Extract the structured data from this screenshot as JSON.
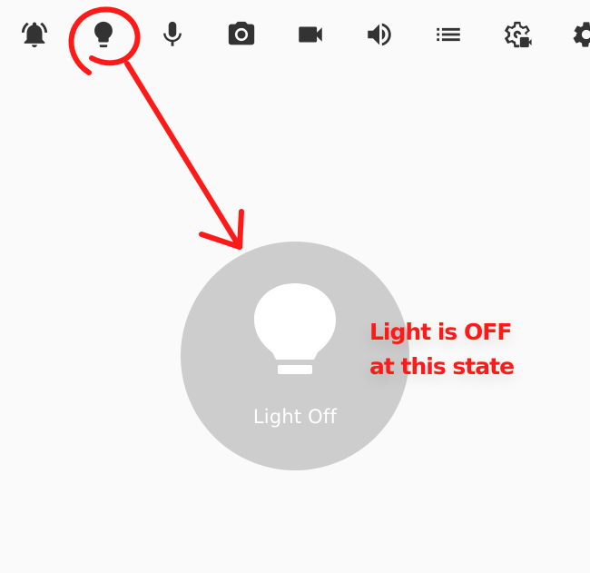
{
  "toolbar": {
    "items": [
      {
        "icon": "alarm-bell-icon"
      },
      {
        "icon": "lightbulb-icon",
        "highlighted": true
      },
      {
        "icon": "microphone-icon"
      },
      {
        "icon": "camera-icon"
      },
      {
        "icon": "video-camera-icon"
      },
      {
        "icon": "volume-icon"
      },
      {
        "icon": "list-icon"
      },
      {
        "icon": "camera-settings-icon"
      },
      {
        "icon": "settings-gear-icon"
      }
    ]
  },
  "light": {
    "state": "off",
    "label": "Light Off",
    "circle_color": "#cdcdcd"
  },
  "annotation": {
    "line1": "Light is OFF",
    "line2": "at this state",
    "color": "#ff1a1a"
  }
}
